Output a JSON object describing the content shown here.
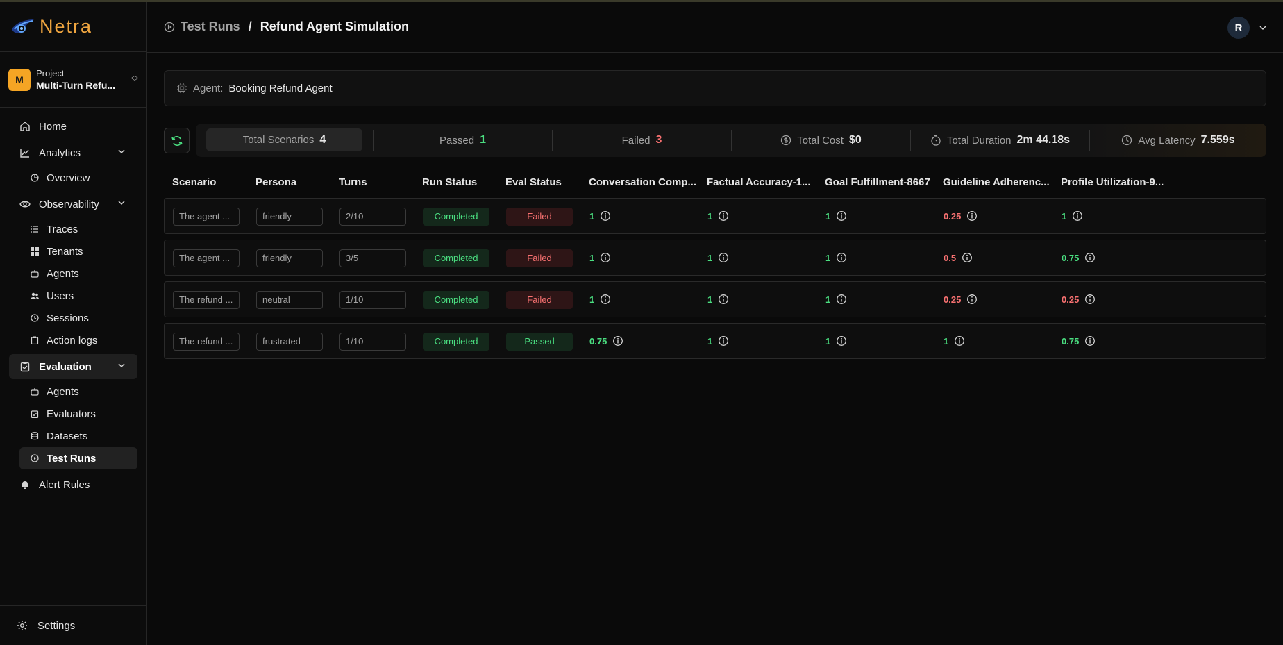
{
  "app": {
    "name": "Netra"
  },
  "project": {
    "label": "Project",
    "name": "Multi-Turn Refu...",
    "badge": "M"
  },
  "sidebar": {
    "home": "Home",
    "analytics": {
      "label": "Analytics",
      "items": [
        "Overview"
      ]
    },
    "observability": {
      "label": "Observability",
      "items": [
        "Traces",
        "Tenants",
        "Agents",
        "Users",
        "Sessions",
        "Action logs"
      ]
    },
    "evaluation": {
      "label": "Evaluation",
      "items": [
        "Agents",
        "Evaluators",
        "Datasets",
        "Test Runs"
      ]
    },
    "alert_rules": "Alert Rules",
    "settings": "Settings"
  },
  "header": {
    "parent": "Test Runs",
    "separator": "/",
    "current": "Refund Agent Simulation",
    "avatar_initial": "R"
  },
  "agent": {
    "label": "Agent:",
    "value": "Booking Refund Agent"
  },
  "stats": {
    "total_label": "Total Scenarios",
    "total_value": "4",
    "passed_label": "Passed",
    "passed_value": "1",
    "failed_label": "Failed",
    "failed_value": "3",
    "cost_label": "Total Cost",
    "cost_value": "$0",
    "duration_label": "Total Duration",
    "duration_value": "2m 44.18s",
    "latency_label": "Avg Latency",
    "latency_value": "7.559s"
  },
  "table": {
    "headers": [
      "Scenario",
      "Persona",
      "Turns",
      "Run Status",
      "Eval Status",
      "Conversation Comp...",
      "Factual Accuracy-1...",
      "Goal Fulfillment-8667",
      "Guideline Adherenc...",
      "Profile Utilization-9..."
    ],
    "rows": [
      {
        "scenario": "The agent ...",
        "persona": "friendly",
        "turns": "2/10",
        "run_status": "Completed",
        "eval_status": "Failed",
        "scores": [
          "1",
          "1",
          "1",
          "0.25",
          "1"
        ]
      },
      {
        "scenario": "The agent ...",
        "persona": "friendly",
        "turns": "3/5",
        "run_status": "Completed",
        "eval_status": "Failed",
        "scores": [
          "1",
          "1",
          "1",
          "0.5",
          "0.75"
        ]
      },
      {
        "scenario": "The refund ...",
        "persona": "neutral",
        "turns": "1/10",
        "run_status": "Completed",
        "eval_status": "Failed",
        "scores": [
          "1",
          "1",
          "1",
          "0.25",
          "0.25"
        ]
      },
      {
        "scenario": "The refund ...",
        "persona": "frustrated",
        "turns": "1/10",
        "run_status": "Completed",
        "eval_status": "Passed",
        "scores": [
          "0.75",
          "1",
          "1",
          "1",
          "0.75"
        ]
      }
    ]
  },
  "colors": {
    "accent": "#f0a640",
    "pass": "#4ade80",
    "fail": "#f87171"
  }
}
